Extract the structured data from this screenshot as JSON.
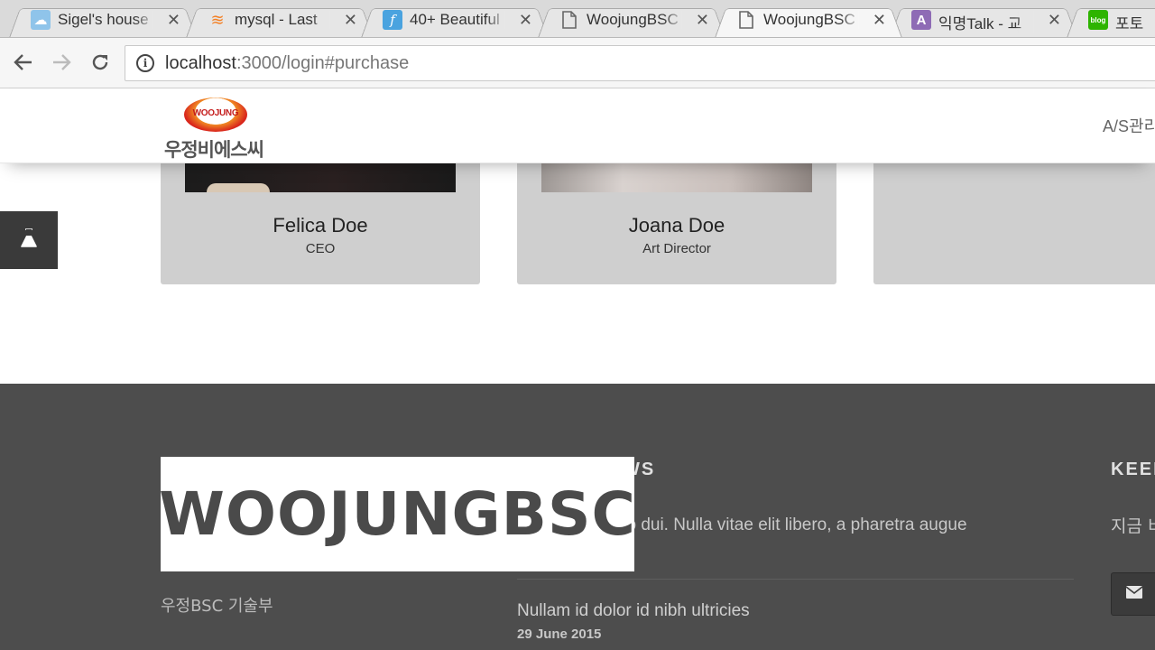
{
  "browser": {
    "tabs": [
      {
        "title": "Sigel's house",
        "favicon": "weather-icon",
        "color": "#6fa8dc"
      },
      {
        "title": "mysql - Last",
        "favicon": "stackoverflow-icon",
        "color": "#f48024"
      },
      {
        "title": "40+ Beautiful",
        "favicon": "f-icon",
        "color": "#4aa3df"
      },
      {
        "title": "WoojungBSC",
        "favicon": "page-icon",
        "color": "#777777"
      },
      {
        "title": "WoojungBSC",
        "favicon": "page-icon",
        "color": "#777777"
      },
      {
        "title": "익명Talk - 교",
        "favicon": "a-icon",
        "color": "#8e6bb5"
      },
      {
        "title": "포토",
        "favicon": "blog-icon",
        "color": "#2db400"
      }
    ],
    "address": {
      "host": "localhost",
      "rest": ":3000/login#purchase"
    }
  },
  "header": {
    "logo_badge": "WOOJUNG",
    "logo_text": "우정비에스씨",
    "nav_partial": "A/S관리"
  },
  "team": [
    {
      "name": "Felica Doe",
      "role": "CEO"
    },
    {
      "name": "Joana Doe",
      "role": "Art Director"
    },
    {
      "name": "",
      "role": ""
    }
  ],
  "footer": {
    "brand": "WOOJUNGBSC",
    "dept": "우정BSC 기술부",
    "news_heading": "WS",
    "news": [
      {
        "title": "Donec sed odio dui. Nulla vitae elit libero, a pharetra augue",
        "date": ""
      },
      {
        "title": "Nullam id dolor id nibh ultricies",
        "date": "29 June 2015"
      }
    ],
    "keep_heading": "KEEP",
    "keep_text": "지금 비"
  }
}
